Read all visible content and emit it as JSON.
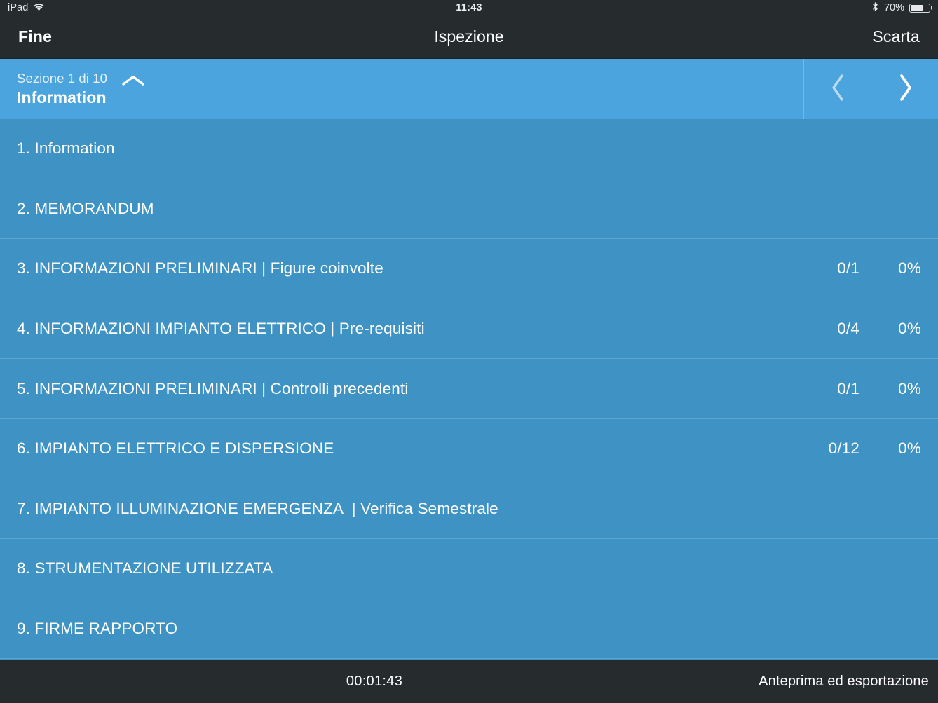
{
  "status_bar": {
    "device": "iPad",
    "wifi_icon": "wifi-icon",
    "time": "11:43",
    "bluetooth_icon": "bluetooth-icon",
    "battery_percent": "70%",
    "battery_level": 70,
    "battery_icon": "battery-icon"
  },
  "nav_bar": {
    "left_button": "Fine",
    "title": "Ispezione",
    "right_button": "Scarta"
  },
  "section_header": {
    "counter": "Sezione 1 di 10",
    "name": "Information",
    "collapse_icon": "chevron-up-icon",
    "prev_icon": "chevron-left-icon",
    "next_icon": "chevron-right-icon",
    "prev_enabled": false,
    "next_enabled": true
  },
  "colors": {
    "header_blue": "#4ba4dd",
    "row_blue": "#3e93c4",
    "row_divider": "#5ba5cf",
    "bar_dark": "#262b2e",
    "text_white": "#ffffff"
  },
  "sections": [
    {
      "label": "1. Information",
      "count": "",
      "percent": ""
    },
    {
      "label": "2. MEMORANDUM",
      "count": "",
      "percent": ""
    },
    {
      "label": "3. INFORMAZIONI PRELIMINARI | Figure coinvolte",
      "count": "0/1",
      "percent": "0%"
    },
    {
      "label": "4. INFORMAZIONI IMPIANTO ELETTRICO | Pre-requisiti",
      "count": "0/4",
      "percent": "0%"
    },
    {
      "label": "5. INFORMAZIONI PRELIMINARI | Controlli precedenti",
      "count": "0/1",
      "percent": "0%"
    },
    {
      "label": "6. IMPIANTO ELETTRICO E DISPERSIONE",
      "count": "0/12",
      "percent": "0%"
    },
    {
      "label": "7. IMPIANTO ILLUMINAZIONE EMERGENZA  | Verifica Semestrale",
      "count": "",
      "percent": ""
    },
    {
      "label": "8. STRUMENTAZIONE UTILIZZATA",
      "count": "",
      "percent": ""
    },
    {
      "label": "9. FIRME RAPPORTO",
      "count": "",
      "percent": ""
    }
  ],
  "bottom_bar": {
    "timer": "00:01:43",
    "export_label": "Anteprima ed esportazione"
  }
}
